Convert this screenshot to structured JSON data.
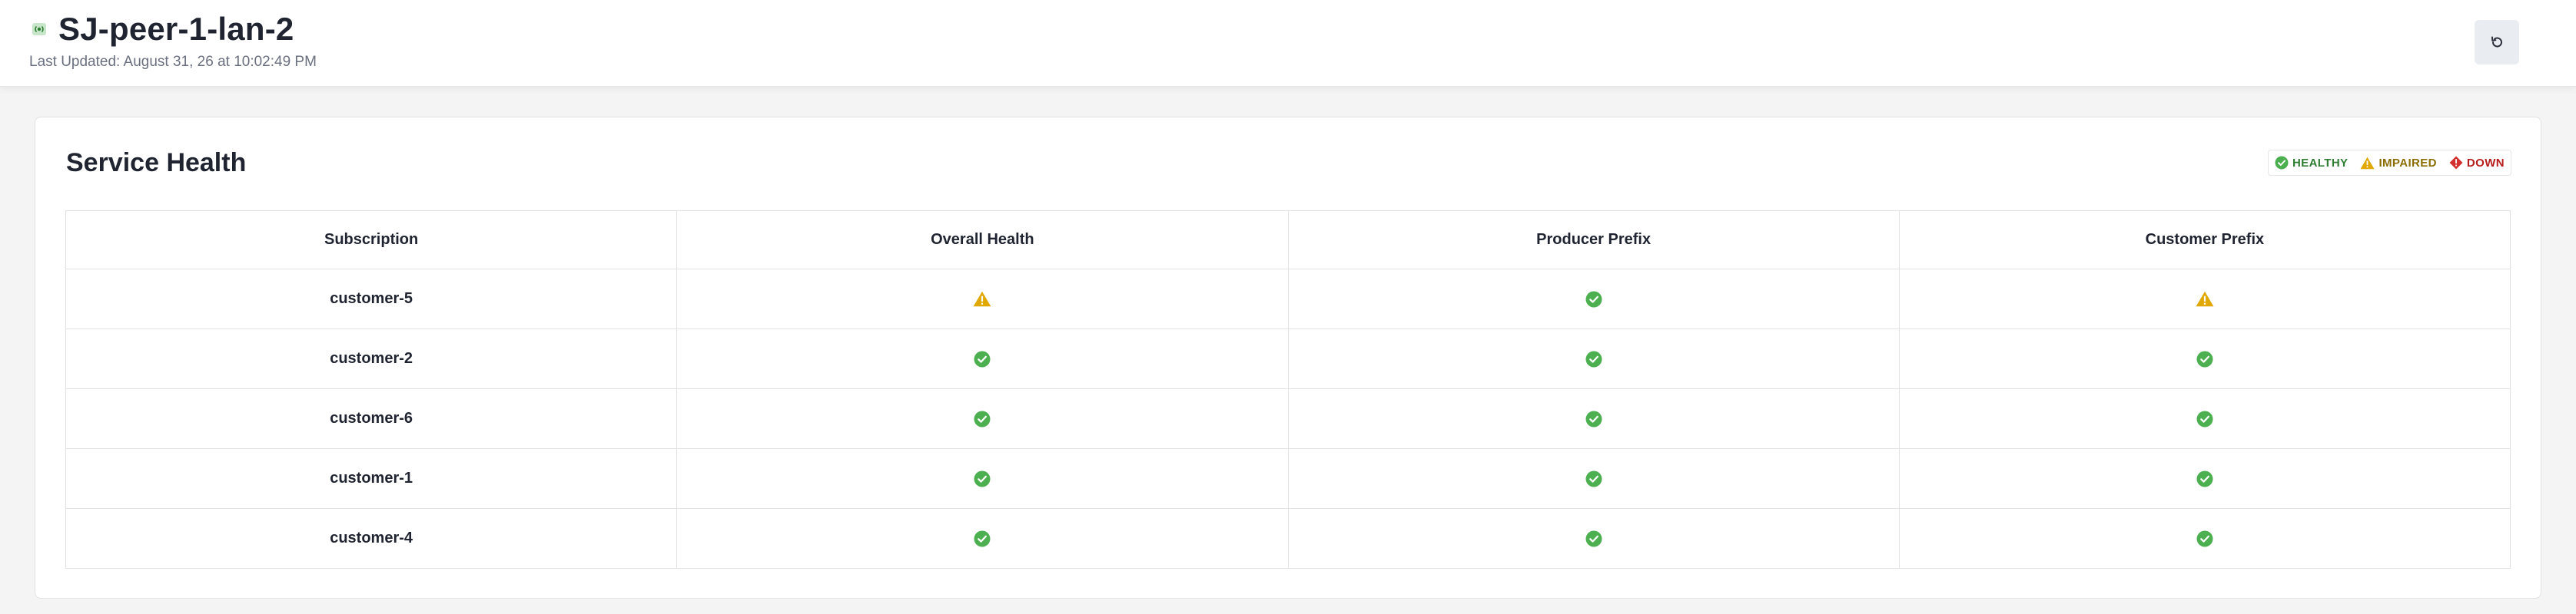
{
  "header": {
    "title": "SJ-peer-1-lan-2",
    "last_updated": "Last Updated: August 31, 26 at 10:02:49 PM",
    "device_icon": "broadcast-icon",
    "refresh_icon": "refresh-icon"
  },
  "service_health": {
    "title": "Service Health",
    "legend": {
      "healthy": "HEALTHY",
      "impaired": "IMPAIRED",
      "down": "DOWN"
    },
    "columns": [
      "Subscription",
      "Overall Health",
      "Producer Prefix",
      "Customer Prefix"
    ],
    "rows": [
      {
        "subscription": "customer-5",
        "overall": "impaired",
        "producer": "healthy",
        "customer": "impaired"
      },
      {
        "subscription": "customer-2",
        "overall": "healthy",
        "producer": "healthy",
        "customer": "healthy"
      },
      {
        "subscription": "customer-6",
        "overall": "healthy",
        "producer": "healthy",
        "customer": "healthy"
      },
      {
        "subscription": "customer-1",
        "overall": "healthy",
        "producer": "healthy",
        "customer": "healthy"
      },
      {
        "subscription": "customer-4",
        "overall": "healthy",
        "producer": "healthy",
        "customer": "healthy"
      }
    ]
  },
  "colors": {
    "healthy": "#4caf50",
    "impaired": "#e0a800",
    "down": "#d32f2f"
  }
}
